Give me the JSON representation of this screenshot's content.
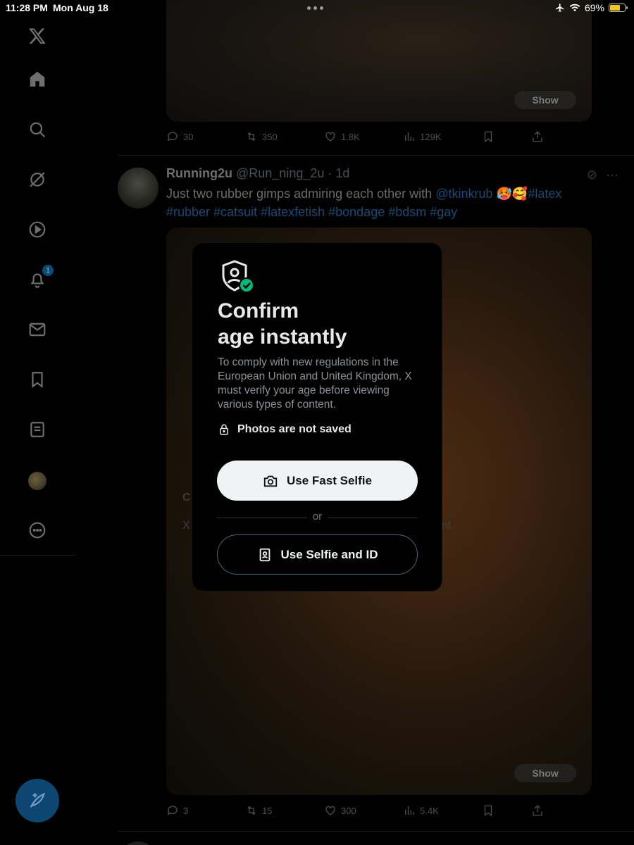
{
  "status_bar": {
    "time": "11:28 PM",
    "date": "Mon Aug 18",
    "battery": "69%",
    "battery_level": 0.69,
    "battery_color": "#f5c518"
  },
  "sidebar": {
    "items": [
      {
        "name": "x-logo-icon"
      },
      {
        "name": "home-icon"
      },
      {
        "name": "search-icon"
      },
      {
        "name": "grok-icon"
      },
      {
        "name": "video-icon"
      },
      {
        "name": "notifications-icon",
        "badge": "1"
      },
      {
        "name": "messages-icon"
      },
      {
        "name": "bookmarks-icon"
      },
      {
        "name": "lists-icon"
      },
      {
        "name": "profile-avatar"
      },
      {
        "name": "more-icon"
      }
    ],
    "compose_icon": "compose-icon"
  },
  "feed": {
    "post1": {
      "show_label": "Show",
      "replies": "30",
      "reposts": "350",
      "likes": "1.8K",
      "views": "129K"
    },
    "post2": {
      "author_name": "Running2u",
      "handle": "@Run_ning_2u",
      "dot": "·",
      "age": "1d",
      "text_prefix": "Just two rubber gimps admiring each other with ",
      "mention": "@tkinkrub",
      "emoji": " 🥵🥰",
      "hashtags_line1": "#latex",
      "hashtags_line2": "#rubber #catsuit #latexfetish #bondage #bdsm #gay",
      "show_label": "Show",
      "replies": "3",
      "reposts": "15",
      "likes": "300",
      "views": "5.4K",
      "ghost_heading": "C",
      "ghost_text_left": "X",
      "ghost_text_right": "nt."
    }
  },
  "modal": {
    "title_line1": "Confirm",
    "title_line2": "age instantly",
    "description": "To comply with new regulations in the European Union and United Kingdom, X must verify your age before viewing various types of content.",
    "note": "Photos are not saved",
    "primary_button": "Use Fast Selfie",
    "divider_text": "or",
    "secondary_button": "Use Selfie and ID",
    "accent_color": "#00ba7c"
  }
}
